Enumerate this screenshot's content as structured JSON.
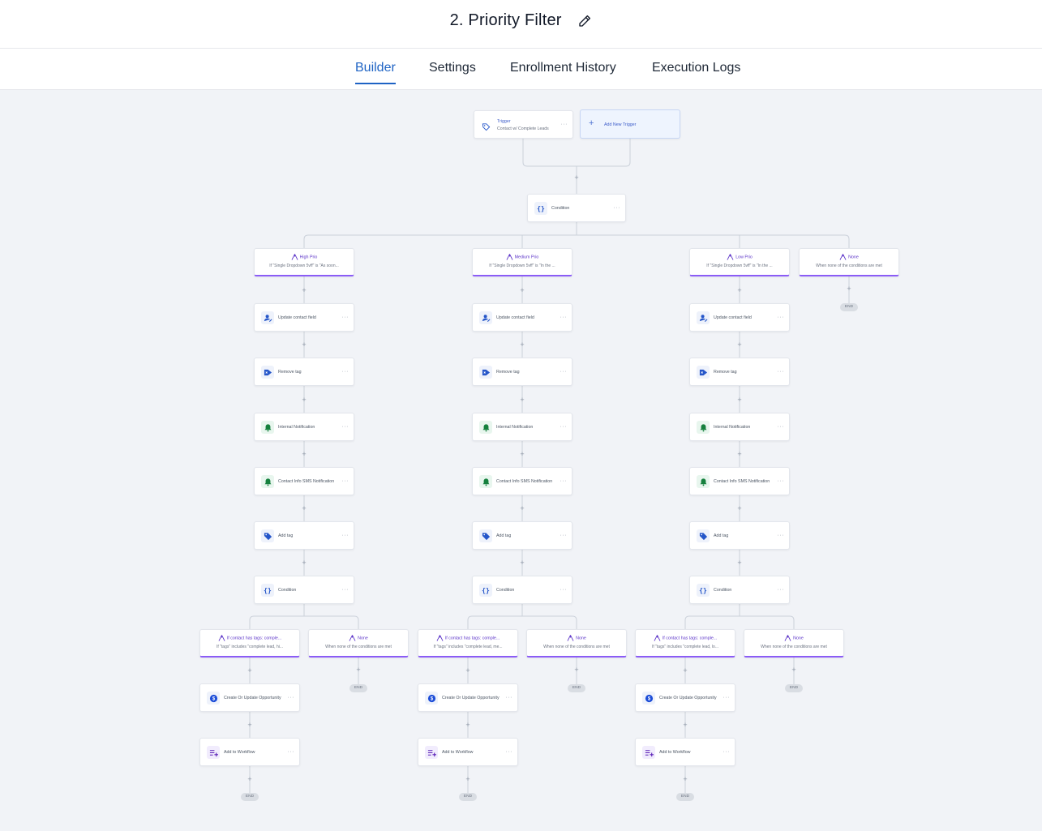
{
  "header": {
    "title": "2. Priority Filter",
    "edit_icon": "pencil-icon"
  },
  "tabs": [
    {
      "label": "Builder",
      "active": true
    },
    {
      "label": "Settings",
      "active": false
    },
    {
      "label": "Enrollment History",
      "active": false
    },
    {
      "label": "Execution Logs",
      "active": false
    }
  ],
  "colors": {
    "accent": "#1e63c4",
    "branch_accent": "#8b5cf6",
    "canvas_bg": "#f1f3f7"
  },
  "trigger": {
    "type_label": "Trigger",
    "name": "Contact w/ Complete Leads",
    "icon": "tag-outline-icon"
  },
  "add_trigger": {
    "label": "Add New Trigger",
    "icon": "plus-icon"
  },
  "root_condition": {
    "label": "Condition",
    "icon": "braces-icon"
  },
  "end_label": "END",
  "branches": [
    {
      "title": "High Prio",
      "subtitle": "If \"Single Dropdown 5vff\" is \"As soon...",
      "actions": [
        {
          "label": "Update contact field",
          "icon": "user-edit-icon"
        },
        {
          "label": "Remove tag",
          "icon": "tag-remove-icon"
        },
        {
          "label": "Internal Notification",
          "icon": "bell-icon"
        },
        {
          "label": "Contact Info SMS Notification",
          "icon": "bell-icon"
        },
        {
          "label": "Add tag",
          "icon": "tag-icon"
        },
        {
          "label": "Condition",
          "icon": "braces-icon"
        }
      ],
      "sub_branches": [
        {
          "title": "If contact has tags: comple...",
          "subtitle": "If \"tags\" includes \"complete lead, hi...",
          "actions": [
            {
              "label": "Create Or Update Opportunity",
              "icon": "dollar-icon"
            },
            {
              "label": "Add to Workflow",
              "icon": "list-add-icon"
            }
          ]
        },
        {
          "title": "None",
          "subtitle": "When none of the conditions are met",
          "actions": []
        }
      ]
    },
    {
      "title": "Medium Prio",
      "subtitle": "If \"Single Dropdown 5vff\" is \"In the ...",
      "actions": [
        {
          "label": "Update contact field",
          "icon": "user-edit-icon"
        },
        {
          "label": "Remove tag",
          "icon": "tag-remove-icon"
        },
        {
          "label": "Internal Notification",
          "icon": "bell-icon"
        },
        {
          "label": "Contact Info SMS Notification",
          "icon": "bell-icon"
        },
        {
          "label": "Add tag",
          "icon": "tag-icon"
        },
        {
          "label": "Condition",
          "icon": "braces-icon"
        }
      ],
      "sub_branches": [
        {
          "title": "If contact has tags: comple...",
          "subtitle": "If \"tags\" includes \"complete lead, me...",
          "actions": [
            {
              "label": "Create Or Update Opportunity",
              "icon": "dollar-icon"
            },
            {
              "label": "Add to Workflow",
              "icon": "list-add-icon"
            }
          ]
        },
        {
          "title": "None",
          "subtitle": "When none of the conditions are met",
          "actions": []
        }
      ]
    },
    {
      "title": "Low Prio",
      "subtitle": "If \"Single Dropdown 5vff\" is \"In the ...",
      "actions": [
        {
          "label": "Update contact field",
          "icon": "user-edit-icon"
        },
        {
          "label": "Remove tag",
          "icon": "tag-remove-icon"
        },
        {
          "label": "Internal Notification",
          "icon": "bell-icon"
        },
        {
          "label": "Contact Info SMS Notification",
          "icon": "bell-icon"
        },
        {
          "label": "Add tag",
          "icon": "tag-icon"
        },
        {
          "label": "Condition",
          "icon": "braces-icon"
        }
      ],
      "sub_branches": [
        {
          "title": "If contact has tags: comple...",
          "subtitle": "If \"tags\" includes \"complete lead, lo...",
          "actions": [
            {
              "label": "Create Or Update Opportunity",
              "icon": "dollar-icon"
            },
            {
              "label": "Add to Workflow",
              "icon": "list-add-icon"
            }
          ]
        },
        {
          "title": "None",
          "subtitle": "When none of the conditions are met",
          "actions": []
        }
      ]
    },
    {
      "title": "None",
      "subtitle": "When none of the conditions are met",
      "actions": [],
      "sub_branches": []
    }
  ]
}
